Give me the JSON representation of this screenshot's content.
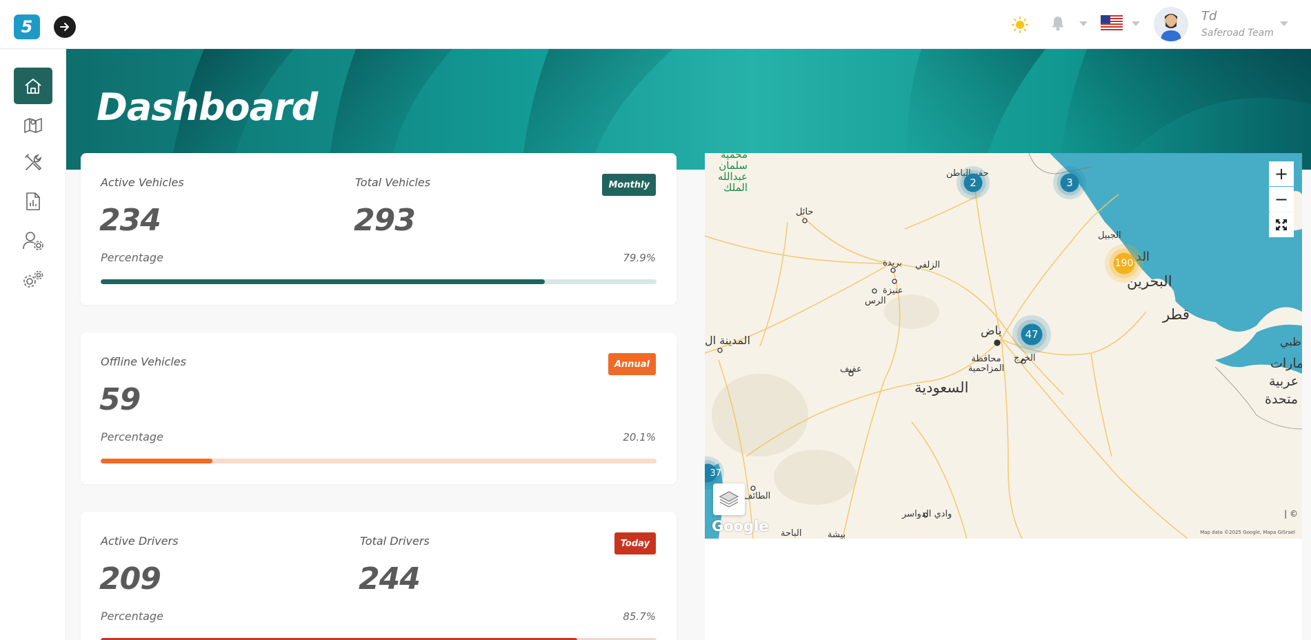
{
  "header": {
    "logo_text": "5",
    "user_name": "Td",
    "user_team": "Saferoad Team",
    "icons": [
      "sun-icon",
      "bell-icon",
      "us-flag-icon",
      "user-avatar"
    ]
  },
  "sidebar": {
    "items": [
      {
        "name": "home",
        "icon": "home-icon",
        "active": true
      },
      {
        "name": "map",
        "icon": "map-icon",
        "active": false
      },
      {
        "name": "tools",
        "icon": "tools-icon",
        "active": false
      },
      {
        "name": "reports",
        "icon": "report-icon",
        "active": false
      },
      {
        "name": "users",
        "icon": "user-settings-icon",
        "active": false
      },
      {
        "name": "settings",
        "icon": "gears-icon",
        "active": false
      }
    ]
  },
  "page": {
    "title": "Dashboard"
  },
  "colors": {
    "primary": "#21645d",
    "orange": "#f06a26",
    "red": "#c9341f",
    "teal_banner": "#1f9f9a"
  },
  "cards": {
    "vehicles": {
      "label_a": "Active Vehicles",
      "value_a": "234",
      "label_b": "Total Vehicles",
      "value_b": "293",
      "badge": "Monthly",
      "percentage_label": "Percentage",
      "percentage": "79.9%",
      "progress": 0.799
    },
    "offline": {
      "label_a": "Offline Vehicles",
      "value_a": "59",
      "badge": "Annual",
      "percentage_label": "Percentage",
      "percentage": "20.1%",
      "progress": 0.201
    },
    "drivers": {
      "label_a": "Active Drivers",
      "value_a": "209",
      "label_b": "Total Drivers",
      "value_b": "244",
      "badge": "Today",
      "percentage_label": "Percentage",
      "percentage": "85.7%",
      "progress": 0.857
    }
  },
  "map": {
    "zoom_in": "+",
    "zoom_out": "−",
    "clusters": [
      {
        "count": "2",
        "color": "#1b7fa6"
      },
      {
        "count": "3",
        "color": "#1b7fa6"
      },
      {
        "count": "190",
        "color": "#f3b11c"
      },
      {
        "count": "47",
        "color": "#1b7fa6"
      },
      {
        "count": "37",
        "color": "#1b7fa6"
      }
    ],
    "places": {
      "saudi": "السعودية",
      "bahrain": "البحرين",
      "qatar": "قطر",
      "emirates": "مارات",
      "arabia": "عربية",
      "united": "متحدة",
      "hail": "حائل",
      "buraydah": "بريدة",
      "unaizah": "عنيزة",
      "rass": "الرس",
      "zulfi": "الزلفي",
      "riyadh": "ياض",
      "muzahmiyah": "محافظة المزاحمية",
      "kharj": "الخرج",
      "afif": "عفيف",
      "medina": "المدينة ال",
      "taif": "الطائف",
      "dawasir": "وادي الدواسر",
      "jubail": "الجبيل",
      "dammam": "الد",
      "baha": "الباحة",
      "bisha": "بيشة",
      "hafr": "حفر الباطن",
      "reserve": "محمية سلمان عبدالله الملك",
      "abu": "ظبي"
    },
    "google": "Google",
    "attribution": "Map data ©2025 Google, Mapa GISrael",
    "copyright": "| ©"
  }
}
